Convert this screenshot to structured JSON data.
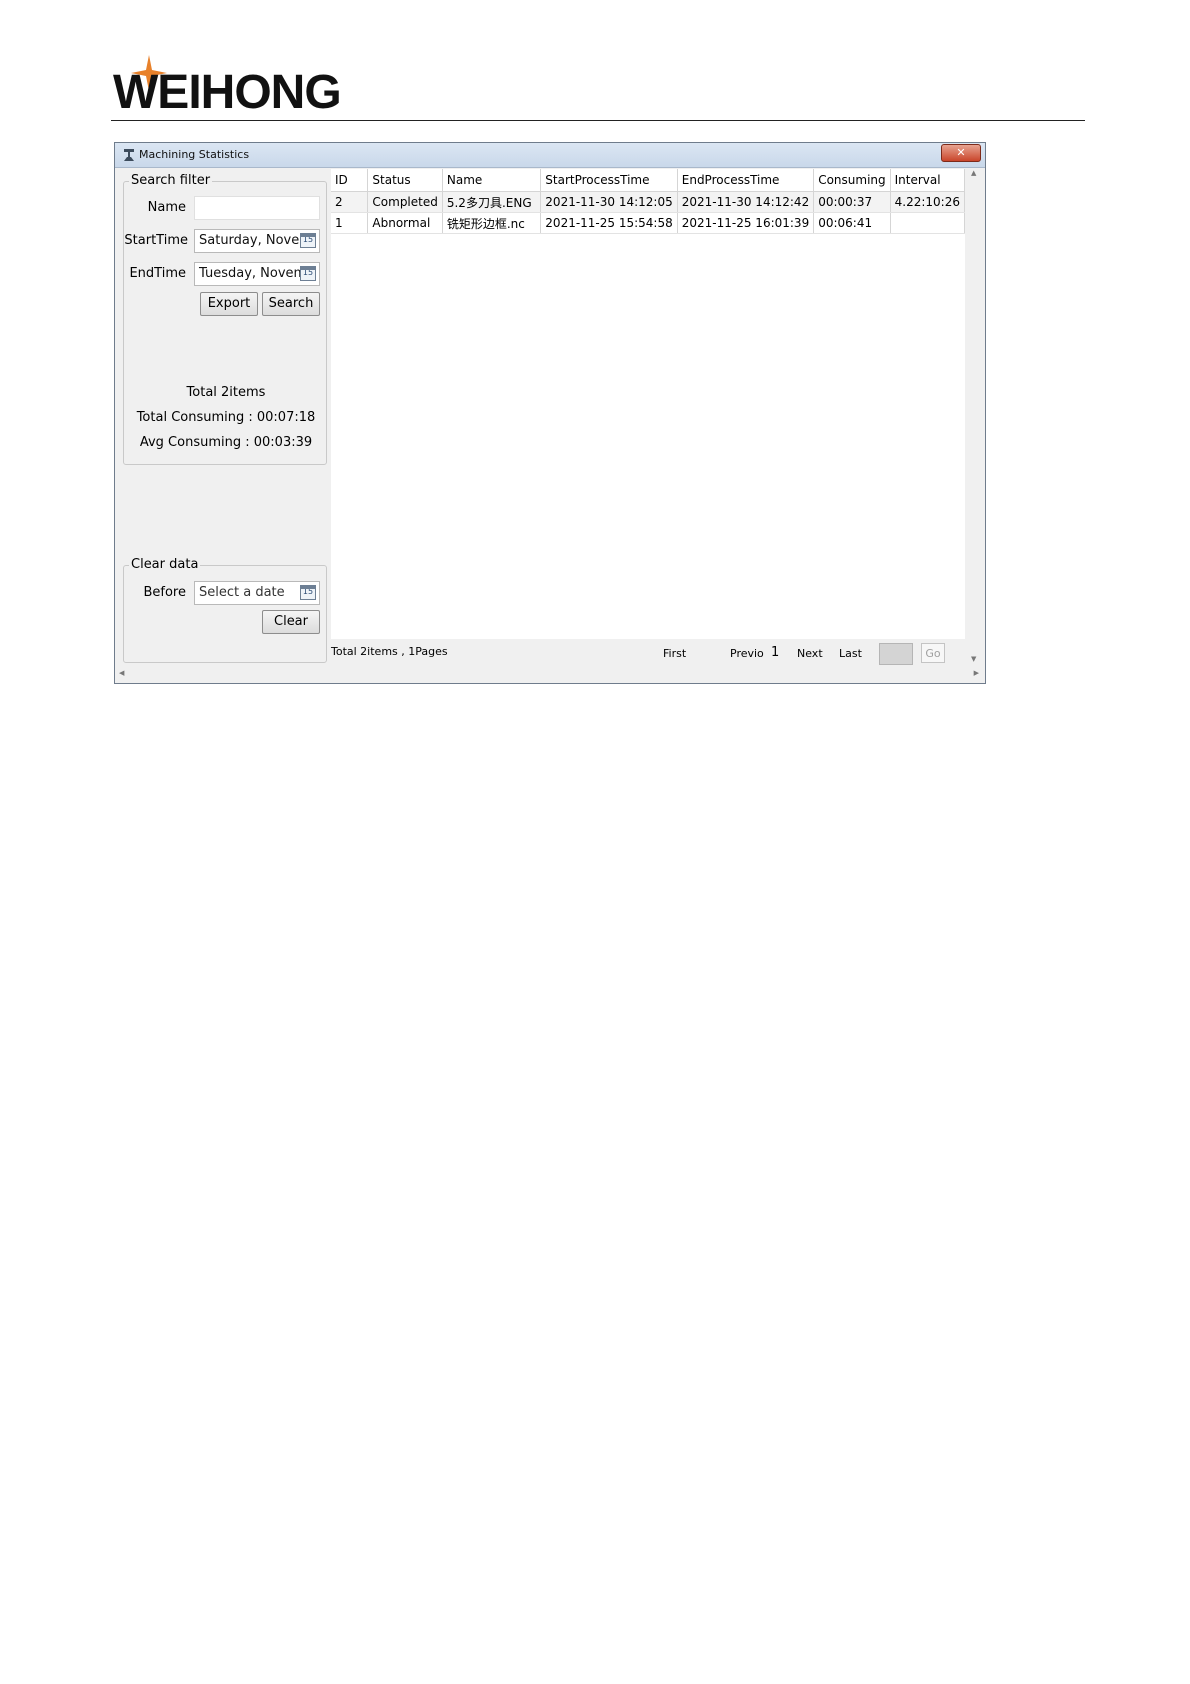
{
  "brand": {
    "name": "WEIHONG"
  },
  "window": {
    "title": "Machining Statistics",
    "close_symbol": "✕"
  },
  "search_filter": {
    "title": "Search filter",
    "name_label": "Name",
    "name_value": "",
    "start_label": "StartTime",
    "start_value": "Saturday, Novem",
    "end_label": "EndTime",
    "end_value": "Tuesday, Novem",
    "export_label": "Export",
    "search_label": "Search",
    "total_items": "Total 2items",
    "total_consuming": "Total Consuming : 00:07:18",
    "avg_consuming": "Avg Consuming : 00:03:39"
  },
  "clear_data": {
    "title": "Clear data",
    "before_label": "Before",
    "before_placeholder": "Select a date",
    "clear_label": "Clear"
  },
  "calendar_icon_text": "15",
  "table": {
    "columns": [
      "ID",
      "Status",
      "Name",
      "StartProcessTime",
      "EndProcessTime",
      "Consuming",
      "Interval"
    ],
    "rows": [
      [
        "2",
        "Completed",
        "5.2多刀具.ENG",
        "2021-11-30 14:12:05",
        "2021-11-30 14:12:42",
        "00:00:37",
        "4.22:10:26"
      ],
      [
        "1",
        "Abnormal",
        "铣矩形边框.nc",
        "2021-11-25 15:54:58",
        "2021-11-25 16:01:39",
        "00:06:41",
        ""
      ]
    ]
  },
  "pager": {
    "summary": "Total 2items , 1Pages",
    "first": "First",
    "previous": "Previo",
    "current_page": "1",
    "next": "Next",
    "last": "Last",
    "page_input": "",
    "go": "Go"
  },
  "colors": {
    "logo_star": "#e8812a",
    "logo_text": "#111111",
    "close_button": "#c9452b"
  }
}
